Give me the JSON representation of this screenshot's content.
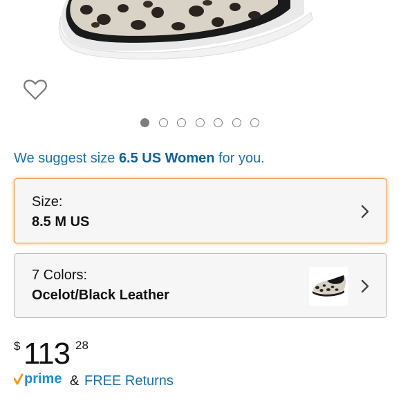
{
  "size_suggestion": {
    "prefix": "We suggest size ",
    "size": "6.5 US Women",
    "suffix": " for you."
  },
  "carousel": {
    "total": 7,
    "active_index": 0
  },
  "size_selector": {
    "label": "Size:",
    "value": "8.5 M US"
  },
  "color_selector": {
    "label": "7 Colors:",
    "value": "Ocelot/Black Leather"
  },
  "price": {
    "currency": "$",
    "whole": "113",
    "fraction": "28"
  },
  "shipping": {
    "prime_text": "prime",
    "connector": "&",
    "returns_text": "FREE Returns"
  },
  "colors": {
    "link": "#1c6fa6",
    "highlight": "#e7953a",
    "prime_orange": "#f49a1c",
    "prime_blue": "#1c8ecd"
  },
  "icons": {
    "wishlist": "heart-outline-icon",
    "chevron": "chevron-right-icon"
  }
}
